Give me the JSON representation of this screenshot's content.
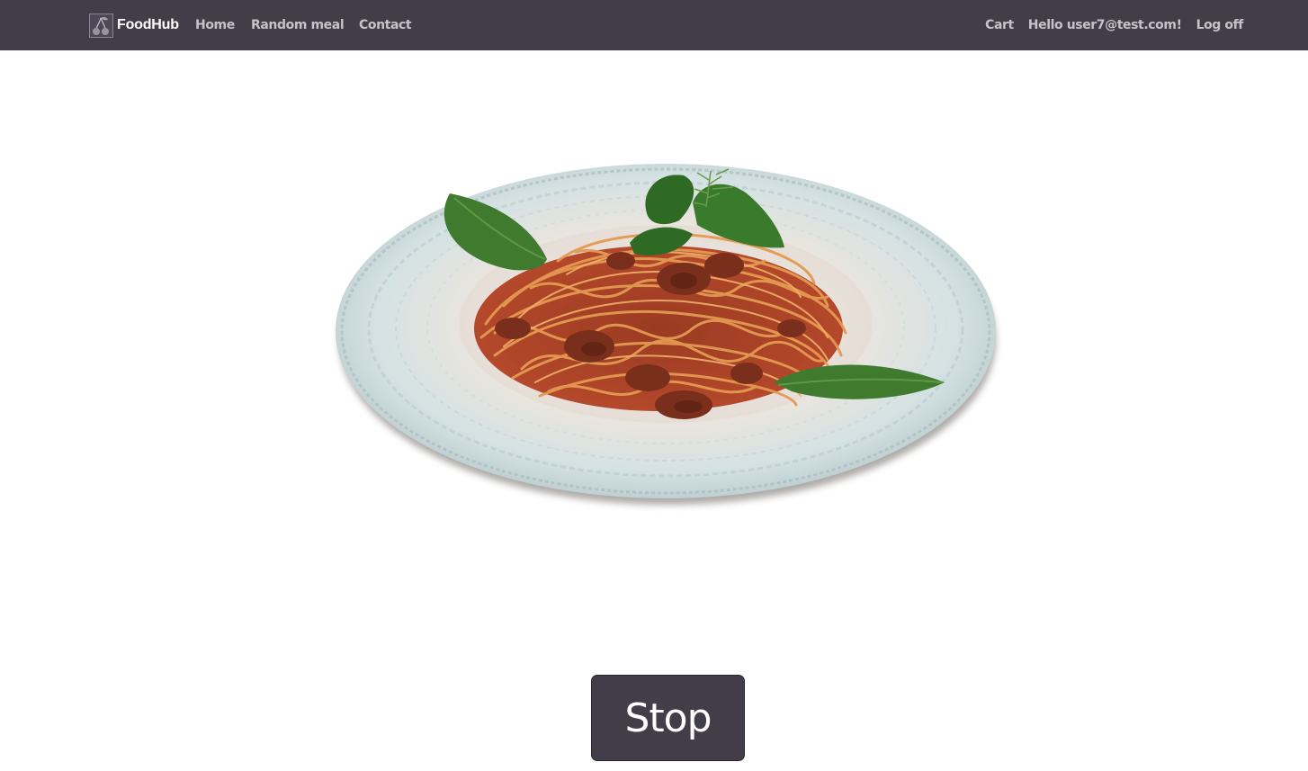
{
  "navbar": {
    "brand": "FoodHub",
    "links": {
      "home": "Home",
      "random_meal": "Random meal",
      "contact": "Contact"
    },
    "user": {
      "cart": "Cart",
      "greeting": "Hello user7@test.com!",
      "logoff": "Log off"
    },
    "background_color": "#433d4a"
  },
  "main": {
    "meal_image": {
      "alt": "Spaghetti bolognese with basil"
    },
    "stop_button_label": "Stop"
  },
  "icons": {
    "brand_logo": "cherry-icon"
  }
}
